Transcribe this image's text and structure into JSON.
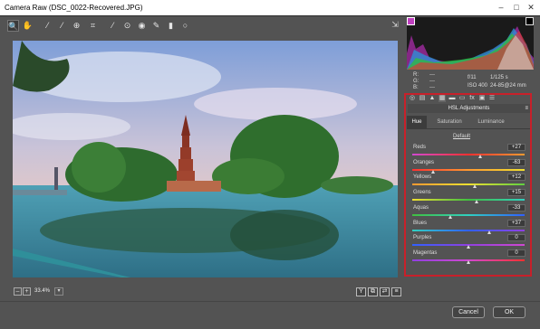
{
  "window": {
    "title": "Camera Raw (DSC_0022-Recovered.JPG)"
  },
  "window_controls": {
    "minimize": "–",
    "maximize": "□",
    "close": "✕"
  },
  "toolbar": {
    "tools": [
      {
        "name": "zoom-tool-icon",
        "glyph": "🔍"
      },
      {
        "name": "hand-tool-icon",
        "glyph": "✋"
      },
      {
        "name": "white-balance-tool-icon",
        "glyph": "⁄"
      },
      {
        "name": "color-sampler-tool-icon",
        "glyph": "⁄"
      },
      {
        "name": "targeted-adjustment-tool-icon",
        "glyph": "⊕"
      },
      {
        "name": "crop-tool-icon",
        "glyph": "⌗"
      },
      {
        "name": "straighten-tool-icon",
        "glyph": "⁄"
      },
      {
        "name": "spot-removal-tool-icon",
        "glyph": "⊙"
      },
      {
        "name": "red-eye-tool-icon",
        "glyph": "◉"
      },
      {
        "name": "adjustment-brush-icon",
        "glyph": "✎"
      },
      {
        "name": "graduated-filter-icon",
        "glyph": "▮"
      },
      {
        "name": "radial-filter-icon",
        "glyph": "○"
      }
    ],
    "open_preferences_glyph": "⇲"
  },
  "status": {
    "zoom": "33.4%",
    "zoom_out": "–",
    "zoom_in": "+",
    "dropdown": "▾"
  },
  "view_buttons": [
    "Y",
    "⧉",
    "⇄",
    "≡"
  ],
  "histogram": {},
  "readout": {
    "r_label": "R:",
    "r_value": "---",
    "g_label": "G:",
    "g_value": "---",
    "b_label": "B:",
    "b_value": "---",
    "aperture": "f/11",
    "shutter": "1/125 s",
    "iso": "ISO 400",
    "lens": "24-85@24 mm"
  },
  "panel_tabs": [
    "◎",
    "▤",
    "▲",
    "▦",
    "▬",
    "▭",
    "fx",
    "▣",
    "☰"
  ],
  "panel": {
    "title": "HSL Adjustments",
    "menu_glyph": "≡"
  },
  "subtabs": [
    "Hue",
    "Saturation",
    "Luminance"
  ],
  "default_link": "Default",
  "hsl": [
    {
      "label": "Reds",
      "value": "+27",
      "level": 0.608,
      "grad": "linear-gradient(to right,#d048d0,#ff3030,#ff9a30)"
    },
    {
      "label": "Oranges",
      "value": "-63",
      "level": 0.185,
      "grad": "linear-gradient(to right,#ff3030,#ff9a30,#f0e030)"
    },
    {
      "label": "Yellows",
      "value": "+12",
      "level": 0.56,
      "grad": "linear-gradient(to right,#ff9a30,#f0e030,#60d040)"
    },
    {
      "label": "Greens",
      "value": "+15",
      "level": 0.575,
      "grad": "linear-gradient(to right,#f0e030,#40c040,#30d0c0)"
    },
    {
      "label": "Aquas",
      "value": "-33",
      "level": 0.335,
      "grad": "linear-gradient(to right,#40c040,#30d0c0,#3060ff)"
    },
    {
      "label": "Blues",
      "value": "+37",
      "level": 0.685,
      "grad": "linear-gradient(to right,#30d0c0,#3060ff,#9040e0)"
    },
    {
      "label": "Purples",
      "value": "0",
      "level": 0.5,
      "grad": "linear-gradient(to right,#3060ff,#9040e0,#d048d0)"
    },
    {
      "label": "Magentas",
      "value": "0",
      "level": 0.5,
      "grad": "linear-gradient(to right,#9040e0,#d048d0,#ff3030)"
    }
  ],
  "buttons": {
    "cancel": "Cancel",
    "ok": "OK"
  },
  "colors": {
    "highlight_box": "#c8202a",
    "background": "#535353"
  }
}
